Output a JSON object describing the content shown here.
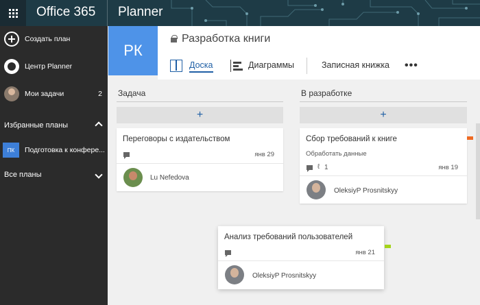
{
  "topbar": {
    "brand": "Office 365",
    "app": "Planner"
  },
  "sidebar": {
    "create_plan": "Создать план",
    "hub": "Центр Planner",
    "my_tasks": "Мои задачи",
    "my_tasks_count": "2",
    "favorites_header": "Избранные планы",
    "favorite_plans": [
      {
        "initials": "ПК",
        "label": "Подготовка к конфере..."
      }
    ],
    "all_plans_header": "Все планы"
  },
  "plan": {
    "initials": "РК",
    "title": "Разработка книги",
    "tabs": {
      "board": "Доска",
      "charts": "Диаграммы",
      "notebook": "Записная книжка",
      "more": "•••"
    }
  },
  "buckets": [
    {
      "name": "Задача",
      "add_label": "+",
      "tasks": [
        {
          "title": "Переговоры с издательством",
          "due": "янв 29",
          "assignee": "Lu Nefedova"
        }
      ]
    },
    {
      "name": "В разработке",
      "add_label": "+",
      "tasks": [
        {
          "title": "Сбор требований к книге",
          "subtitle": "Обработать данные",
          "attachments": "1",
          "due": "янв 19",
          "assignee": "OleksiyP Prosnitskyy",
          "label_color": "#ef6a23"
        }
      ]
    }
  ],
  "dragged_card": {
    "title": "Анализ требований пользователей",
    "due": "янв 21",
    "assignee": "OleksiyP Prosnitskyy",
    "label_color": "#a4d41a"
  },
  "colors": {
    "accent": "#1f5fa5",
    "sidebar": "#2b2b2b",
    "plan_tile": "#4e93e8",
    "topbar": "#1e3b46"
  }
}
